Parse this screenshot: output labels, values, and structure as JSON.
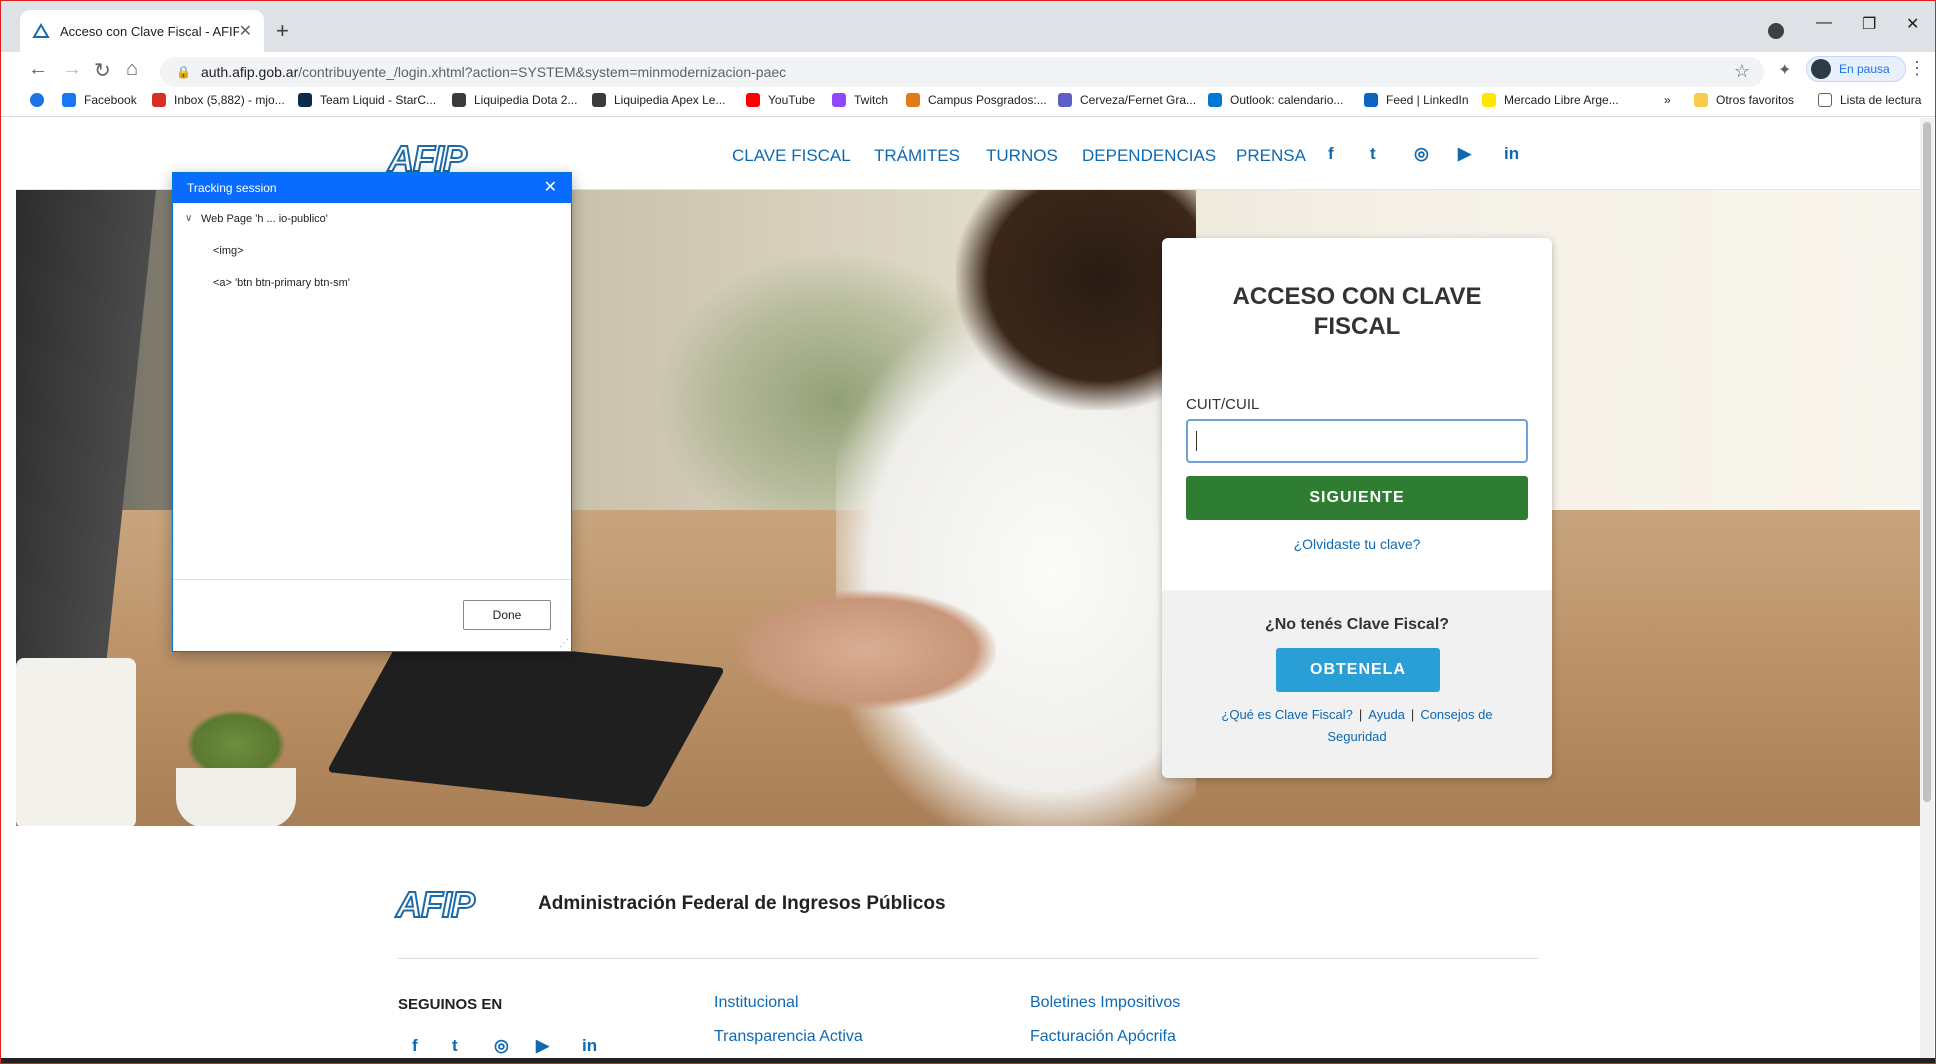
{
  "browser": {
    "tab_title": "Acceso con Clave Fiscal - AFIP",
    "url_host": "auth.afip.gob.ar",
    "url_path": "/contribuyente_/login.xhtml?action=SYSTEM&system=minmodernizacion-paec",
    "profile_label": "En pausa",
    "bookmarks": [
      {
        "label": "Facebook",
        "color": "#1877f2"
      },
      {
        "label": "Inbox (5,882) - mjo...",
        "color": "#d93025"
      },
      {
        "label": "Team Liquid - StarC...",
        "color": "#0b2b4b"
      },
      {
        "label": "Liquipedia Dota 2...",
        "color": "#3b3b3b"
      },
      {
        "label": "Liquipedia Apex Le...",
        "color": "#3b3b3b"
      },
      {
        "label": "YouTube",
        "color": "#ff0000"
      },
      {
        "label": "Twitch",
        "color": "#9146ff"
      },
      {
        "label": "Campus Posgrados:...",
        "color": "#e07b1a"
      },
      {
        "label": "Cerveza/Fernet Gra...",
        "color": "#5b5fc7"
      },
      {
        "label": "Outlook: calendario...",
        "color": "#0078d4"
      },
      {
        "label": "Feed | LinkedIn",
        "color": "#0a66c2"
      },
      {
        "label": "Mercado Libre Arge...",
        "color": "#ffe600"
      }
    ],
    "overflow_label": "»",
    "other_favorites": "Otros favoritos",
    "reading_list": "Lista de lectura"
  },
  "site": {
    "logo_text": "AFIP",
    "nav": [
      "CLAVE FISCAL",
      "TRÁMITES",
      "TURNOS",
      "DEPENDENCIAS",
      "PRENSA"
    ],
    "social_icons": [
      "facebook-icon",
      "twitter-icon",
      "instagram-icon",
      "youtube-icon",
      "linkedin-icon"
    ],
    "social_glyphs": [
      "f",
      "t",
      "◎",
      "▶",
      "in"
    ]
  },
  "login": {
    "title": "ACCESO CON CLAVE FISCAL",
    "cuit_label": "CUIT/CUIL",
    "cuit_value": "",
    "next_button": "SIGUIENTE",
    "forgot_link": "¿Olvidaste tu clave?",
    "no_clave": "¿No tenés Clave Fiscal?",
    "get_button": "OBTENELA",
    "link_what": "¿Qué es Clave Fiscal?",
    "link_help": "Ayuda",
    "link_security": "Consejos de Seguridad",
    "separator": "|"
  },
  "footer": {
    "logo_text": "AFIP",
    "title": "Administración Federal de Ingresos Públicos",
    "follow_us": "SEGUINOS EN",
    "col2": [
      "Institucional",
      "Transparencia Activa"
    ],
    "col3": [
      "Boletines Impositivos",
      "Facturación Apócrifa"
    ]
  },
  "tracking_dialog": {
    "title": "Tracking session",
    "root_item": "Web Page 'h ... io-publico'",
    "children": [
      "<img>",
      "<a>  'btn btn-primary btn-sm'"
    ],
    "done_button": "Done"
  },
  "colors": {
    "afip_blue": "#0e69b3",
    "green_button": "#2e7d32",
    "blue_button": "#2a9fd6",
    "dialog_header": "#0a6cff"
  }
}
